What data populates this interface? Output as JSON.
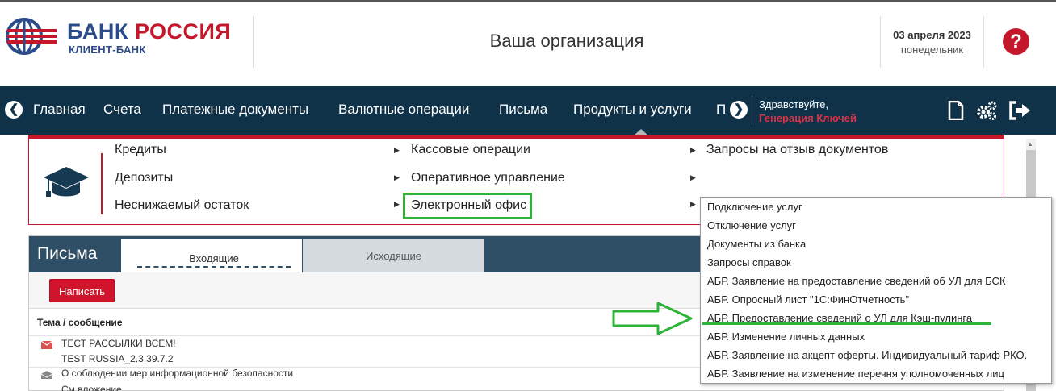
{
  "header": {
    "bank_name_part1": "БАНК",
    "bank_name_part2": "РОССИЯ",
    "bank_sub": "КЛИЕНТ-БАНК",
    "org_title": "Ваша организация",
    "date": "03 апреля 2023",
    "weekday": "понедельник",
    "help_icon": "question-icon",
    "colors": {
      "brand_blue": "#2b4b8a",
      "brand_red": "#c4172c"
    }
  },
  "nav": {
    "items": [
      "Главная",
      "Счета",
      "Платежные документы",
      "Валютные операции",
      "Письма",
      "Продукты и услуги",
      "Прочее"
    ],
    "greeting": "Здравствуйте,",
    "user": "Генерация Ключей",
    "icons": [
      "document-icon",
      "settings-gears-icon",
      "logout-icon"
    ],
    "bg_color": "#0f3248"
  },
  "products_menu": {
    "icon": "graduation-cap-icon",
    "col1": [
      "Кредиты",
      "Депозиты",
      "Неснижаемый остаток"
    ],
    "col2": [
      "Кассовые операции",
      "Оперативное управление",
      "Электронный офис"
    ],
    "col3": [
      "Запросы на отзыв документов"
    ],
    "highlighted": "Электронный офис"
  },
  "submenu": {
    "items": [
      "Подключение услуг",
      "Отключение услуг",
      "Документы из банка",
      "Запросы справок",
      "АБР. Заявление на предоставление сведений об УЛ для БСК",
      "АБР. Опросный лист \"1С:ФинОтчетность\"",
      "АБР. Предоставление сведений о УЛ для Кэш-пулинга",
      "АБР. Изменение личных данных",
      "АБР. Заявление на акцепт оферты. Индивидуальный тариф РКО.",
      "АБР. Заявление на изменение перечня уполномоченных лиц"
    ],
    "highlighted_index": 6
  },
  "letters": {
    "title": "Письма",
    "tab_incoming": "Входящие",
    "tab_outgoing": "Исходящие",
    "write_button": "Написать",
    "column_header": "Тема / сообщение",
    "messages": [
      {
        "subject": "ТЕСТ РАССЫЛКИ ВСЕМ!",
        "detail": "TEST RUSSIA_2.3.39.7.2",
        "unread": true
      },
      {
        "subject": "О соблюдении мер информационной безопасности",
        "detail": "См.вложение",
        "unread": false
      }
    ]
  }
}
